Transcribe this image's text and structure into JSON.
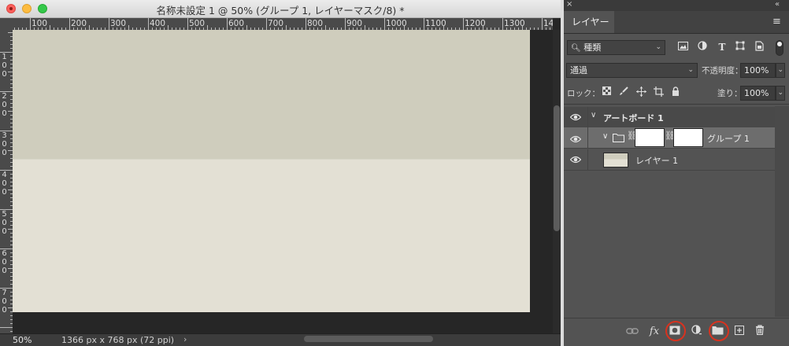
{
  "window": {
    "title": "名称未設定 1 @ 50% (グループ 1, レイヤーマスク/8) *"
  },
  "ruler": {
    "h_labels": [
      "100",
      "200",
      "300",
      "400",
      "500",
      "600",
      "700",
      "800",
      "900",
      "1000",
      "1100",
      "1200",
      "1300",
      "14"
    ],
    "v_labels": [
      [
        "1",
        "0",
        "0"
      ],
      [
        "2",
        "0",
        "0"
      ],
      [
        "3",
        "0",
        "0"
      ],
      [
        "4",
        "0",
        "0"
      ],
      [
        "5",
        "0",
        "0"
      ],
      [
        "6",
        "0",
        "0"
      ],
      [
        "7",
        "0",
        "0"
      ]
    ]
  },
  "artboard": {
    "top_color": "#cfcdbd",
    "bottom_color": "#e3e0d4"
  },
  "status": {
    "zoom": "50%",
    "doc_info": "1366 px x 768 px (72 ppi)",
    "arrow": "›"
  },
  "panel": {
    "close": "×",
    "collapse": "«",
    "tab_label": "レイヤー",
    "menu": "≡",
    "filter_kind": "種類",
    "blend_mode": "通過",
    "opacity_label": "不透明度：",
    "opacity_value": "100%",
    "lock_label": "ロック：",
    "fill_label": "塗り：",
    "fill_value": "100%",
    "layers": [
      {
        "name": "アートボード 1"
      },
      {
        "name": "グループ 1"
      },
      {
        "name": "レイヤー 1"
      }
    ],
    "bottom_icons": [
      "link-layers-icon",
      "fx-icon",
      "add-mask-icon",
      "adjustment-icon",
      "new-group-icon",
      "new-layer-icon",
      "trash-icon"
    ],
    "fx_label": "fx",
    "highlight_color": "#d8321f"
  }
}
